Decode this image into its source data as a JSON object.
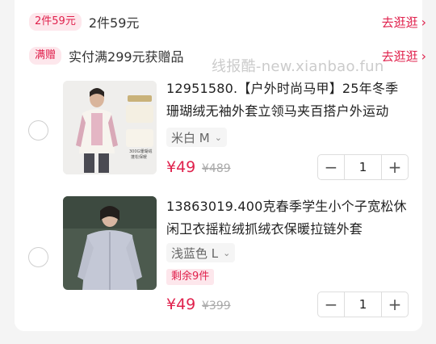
{
  "promos": [
    {
      "badge": "2件59元",
      "text": "2件59元",
      "link": "去逛逛"
    },
    {
      "badge": "满赠",
      "text": "实付满299元获赠品",
      "link": "去逛逛"
    }
  ],
  "watermark": "线报酷-new.xianbao.fun",
  "items": [
    {
      "title": "12951580.【户外时尚马甲】25年冬季珊瑚绒无袖外套立领马夹百搭户外运动",
      "spec": "米白 M",
      "price": "¥49",
      "original_price": "¥489",
      "quantity": "1",
      "image_label_top": "可拆卸羊羔",
      "image_label_bottom": "300G珊瑚绒 蓬松保暖"
    },
    {
      "title": "13863019.400克春季学生小个子宽松休闲卫衣摇粒绒抓绒衣保暖拉链外套",
      "spec": "浅蓝色 L",
      "stock": "剩余9件",
      "price": "¥49",
      "original_price": "¥399",
      "quantity": "1"
    }
  ],
  "icons": {
    "minus": "−",
    "plus": "+",
    "chevron": "›",
    "dropdown": "⌄"
  },
  "colors": {
    "accent": "#e0224d",
    "badge_bg": "#fde7ec"
  }
}
